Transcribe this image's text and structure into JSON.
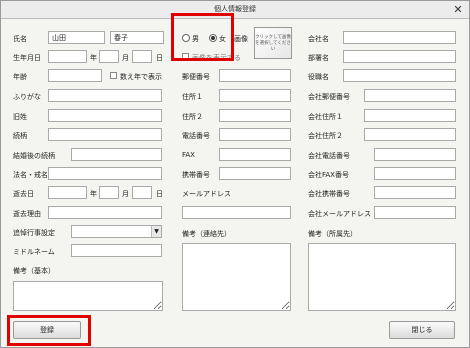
{
  "title": "個人情報登録",
  "close_glyph": "✕",
  "left": {
    "name_label": "氏名",
    "last_name": "山田",
    "first_name": "春子",
    "birth_label": "生年月日",
    "year": "年",
    "month": "月",
    "day": "日",
    "age_label": "年齢",
    "kazoe_label": "数え年で表示",
    "furigana_label": "ふりがな",
    "old_surname_label": "旧姓",
    "relation_label": "続柄",
    "married_relation_label": "結婚後の続柄",
    "buddhist_name_label": "法名・戒名",
    "death_date_label": "逝去日",
    "death_reason_label": "逝去理由",
    "memorial_label": "追悼行事設定",
    "middle_name_label": "ミドルネーム",
    "note_basic_label": "備考（基本）"
  },
  "middle": {
    "gender_male": "男",
    "gender_female": "女",
    "photo_tab_label": "画像",
    "photo_hint": "クリックして画像を選択してください",
    "show_photo_label": "画像を表示する",
    "zip_label": "郵便番号",
    "address1_label": "住所１",
    "address2_label": "住所２",
    "phone_label": "電話番号",
    "fax_label": "FAX",
    "mobile_label": "携帯番号",
    "email_label": "メールアドレス",
    "note_contact_label": "備考（連絡先）"
  },
  "right": {
    "company_label": "会社名",
    "department_label": "部署名",
    "position_label": "役職名",
    "company_zip_label": "会社郵便番号",
    "company_addr1_label": "会社住所１",
    "company_addr2_label": "会社住所２",
    "company_phone_label": "会社電話番号",
    "company_fax_label": "会社FAX番号",
    "company_mobile_label": "会社携帯番号",
    "company_email_label": "会社メールアドレス",
    "note_company_label": "備考（所属先）"
  },
  "buttons": {
    "register": "登録",
    "close": "閉じる"
  },
  "selected": {
    "gender": "female"
  },
  "colors": {
    "highlight": "#e00000"
  }
}
